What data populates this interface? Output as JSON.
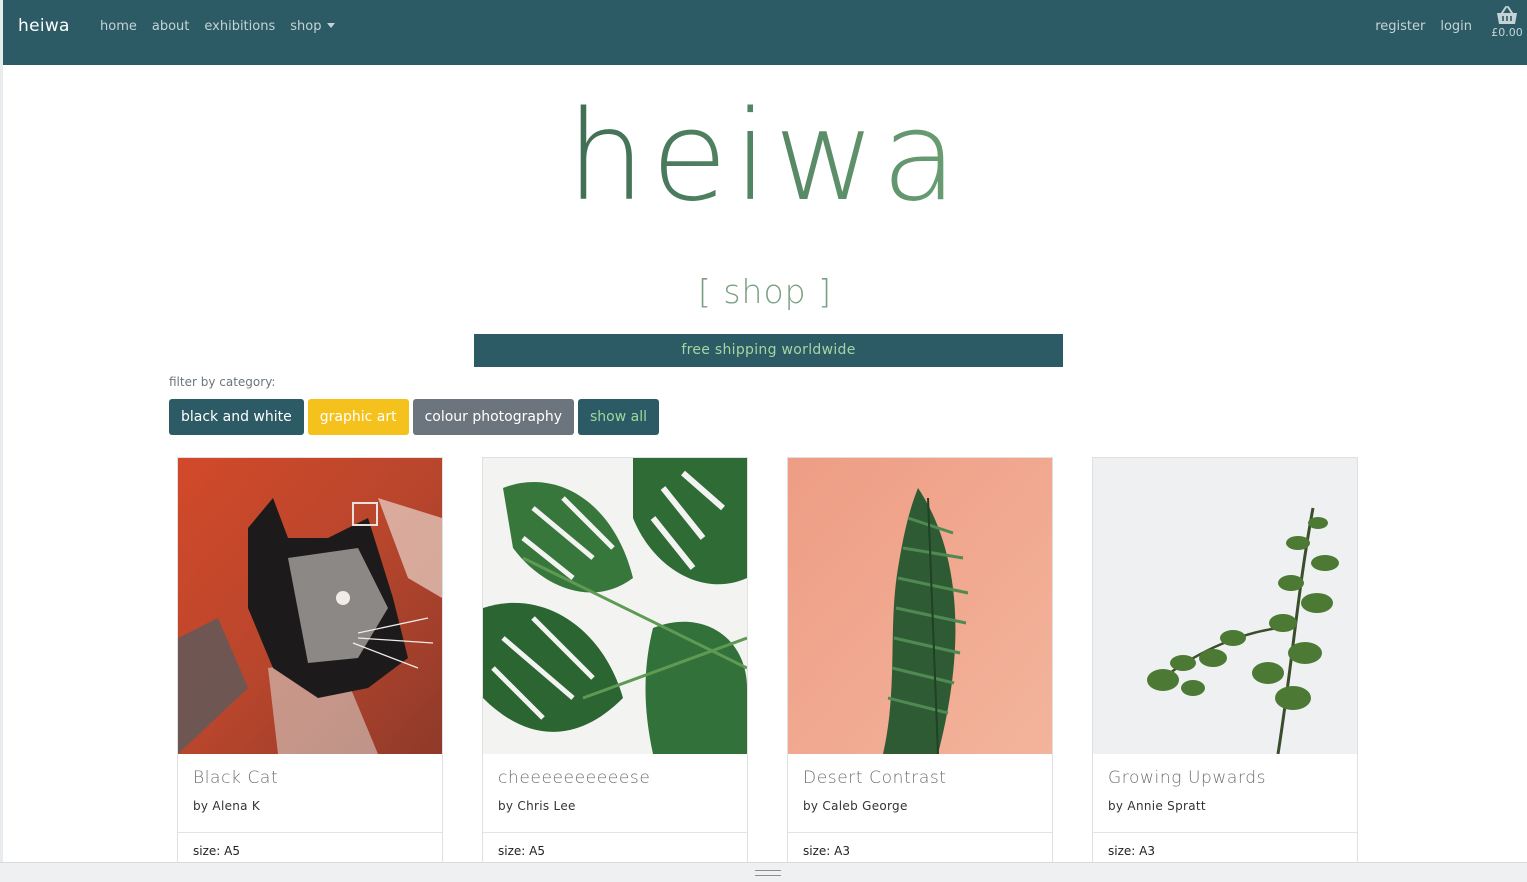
{
  "nav": {
    "brand": "heiwa",
    "links": [
      "home",
      "about",
      "exhibitions",
      "shop"
    ],
    "register": "register",
    "login": "login",
    "basket_total": "£0.00"
  },
  "hero": {
    "title": "heiwa",
    "subtitle": "[ shop ]"
  },
  "banner": "free shipping worldwide",
  "filter": {
    "label": "filter by category:",
    "buttons": [
      "black and white",
      "graphic art",
      "colour photography",
      "show all"
    ]
  },
  "products": [
    {
      "title": "Black Cat",
      "artist": "by Alena K",
      "size": "size: A5"
    },
    {
      "title": "cheeeeeeeeeese",
      "artist": "by Chris Lee",
      "size": "size: A5"
    },
    {
      "title": "Desert Contrast",
      "artist": "by Caleb George",
      "size": "size: A3"
    },
    {
      "title": "Growing Upwards",
      "artist": "by Annie Spratt",
      "size": "size: A3"
    }
  ],
  "colors": {
    "navbar": "#2c5b66",
    "accent_green": "#5d8e6a",
    "yellow": "#f5c11c",
    "grey": "#6c757d"
  },
  "icons": {
    "basket": "basket-icon",
    "dropdown": "chevron-down-icon"
  }
}
